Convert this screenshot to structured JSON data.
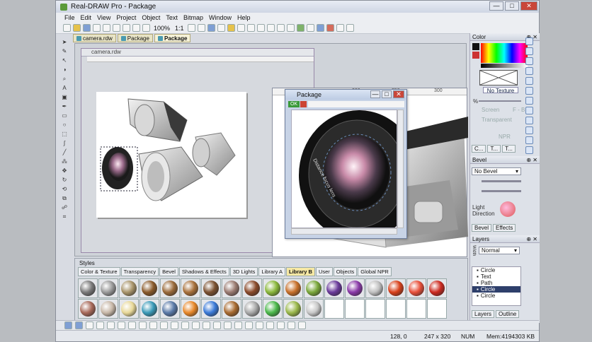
{
  "window": {
    "title": "Real-DRAW Pro - Package",
    "minimize": "—",
    "maximize": "□",
    "close": "✕"
  },
  "menu": [
    "File",
    "Edit",
    "View",
    "Project",
    "Object",
    "Text",
    "Bitmap",
    "Window",
    "Help"
  ],
  "toolbar": {
    "zoom": "100%",
    "ratio": "1:1"
  },
  "doc_tabs": [
    "camera.rdw",
    "Package",
    "Package"
  ],
  "canvas": {
    "doc_title": "camera.rdw",
    "pkg_window_title": "Package",
    "pkg_ok": "OK",
    "lens_text": "Distance focus lens",
    "bg_ruler_ticks": [
      "250",
      "200",
      "150",
      "100"
    ],
    "bg_ruler_ticks2": [
      "200",
      "250",
      "300"
    ]
  },
  "color_panel": {
    "title": "Color",
    "texture_label": "No Texture",
    "opts": [
      "Screen",
      "Transparent",
      "NPR"
    ],
    "f_b": "F - B",
    "percent": "%",
    "tabs": [
      "C...",
      "T...",
      "T..."
    ]
  },
  "bevel_panel": {
    "title": "Bevel",
    "select": "No Bevel",
    "light_direction": "Light\nDirection",
    "tabs": [
      "Bevel",
      "Effects"
    ]
  },
  "layers_panel": {
    "title": "Layers",
    "blend": "Normal",
    "width_label": "Width",
    "rows": [
      {
        "name": "Circle",
        "selected": false
      },
      {
        "name": "Text",
        "selected": false
      },
      {
        "name": "Path",
        "selected": false
      },
      {
        "name": "Circle",
        "selected": true
      },
      {
        "name": "Circle",
        "selected": false
      }
    ],
    "tabs": [
      "Layers",
      "Outline"
    ]
  },
  "styles": {
    "title": "Styles",
    "tabs": [
      "Color & Texture",
      "Transparency",
      "Bevel",
      "Shadows & Effects",
      "3D Lights",
      "Library A",
      "Library B",
      "User",
      "Objects",
      "Global NPR"
    ],
    "active_tab": "Library B",
    "swatch_colors": [
      "#7a7a7a",
      "#9a9a9a",
      "#a8946a",
      "#8a5a2a",
      "#9a6a3a",
      "#a8703a",
      "#7a5030",
      "#9a7a70",
      "#8a4a2a",
      "#8ab83a",
      "#c8702a",
      "#7aa83a",
      "#6a3a9a",
      "#8a3aa8",
      "#c0c0c0",
      "#d8401a",
      "#e8503a",
      "#cc2a20",
      "#a86a5a",
      "#c8b8a8",
      "#e8d898",
      "#3a9ab8",
      "#5a7aa8",
      "#e8882a",
      "#3a7ad8",
      "#a86a30",
      "#a8a8a8",
      "#4ab84a",
      "#9ab84a",
      "#c8c8c8"
    ]
  },
  "status": {
    "coords": "128, 0",
    "size": "247 x 320",
    "num": "NUM",
    "mem": "Mem:4194303 KB"
  },
  "colors": {
    "accent": "#2e3f6b",
    "ok_green": "#3a9a3a",
    "tab_gold": "#f6e8a4"
  }
}
